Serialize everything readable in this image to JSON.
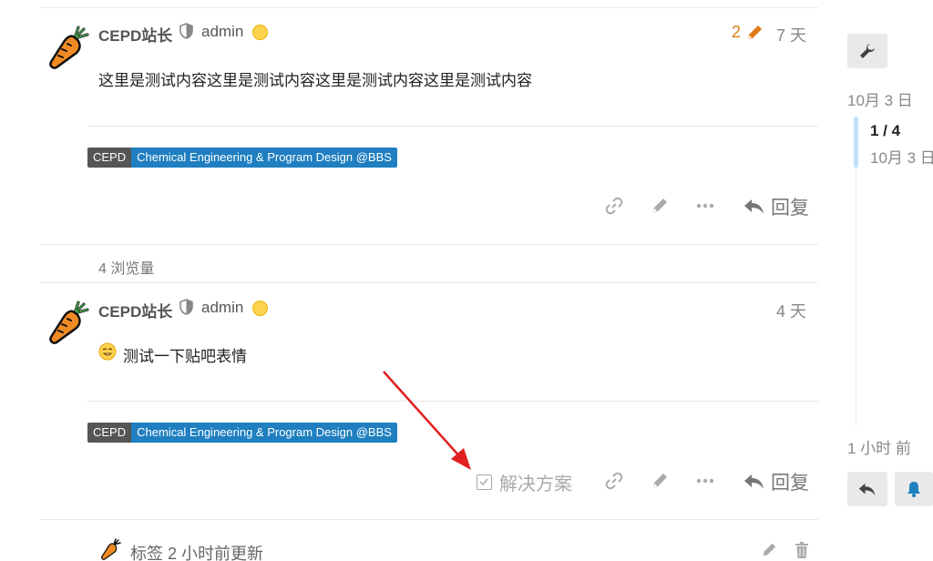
{
  "posts": [
    {
      "username": "CEPD站长",
      "user_title": "admin",
      "edit_count": "2",
      "date": "7 天",
      "content": "这里是测试内容这里是测试内容这里是测试内容这里是测试内容",
      "badge_left": "CEPD",
      "badge_right": "Chemical Engineering & Program Design @BBS",
      "reply_label": "回复"
    },
    {
      "username": "CEPD站长",
      "user_title": "admin",
      "date": "4 天",
      "content": "测试一下贴吧表情",
      "badge_left": "CEPD",
      "badge_right": "Chemical Engineering & Program Design @BBS",
      "solution_label": "解决方案",
      "reply_label": "回复"
    }
  ],
  "views_text": "4 浏览量",
  "small_action": {
    "text": "标签 2 小时前更新"
  },
  "timeline": {
    "start_date": "10月 3 日",
    "position": "1 / 4",
    "position_date": "10月 3 日",
    "end_date": "1 小时 前"
  },
  "colors": {
    "accent_orange": "#e07b1a",
    "badge_blue": "#1f7fc0",
    "badge_dark": "#555555",
    "annotation_arrow": "#e02020",
    "timeline_handle": "#bfe2f8",
    "notification_blue": "#1f7fc0"
  },
  "icons": [
    "carrot-avatar-icon",
    "shield-icon",
    "smiley-emoji-icon",
    "pencil-icon",
    "link-icon",
    "more-icon",
    "reply-icon",
    "checkbox-icon",
    "trash-icon",
    "wrench-icon",
    "bell-icon"
  ]
}
